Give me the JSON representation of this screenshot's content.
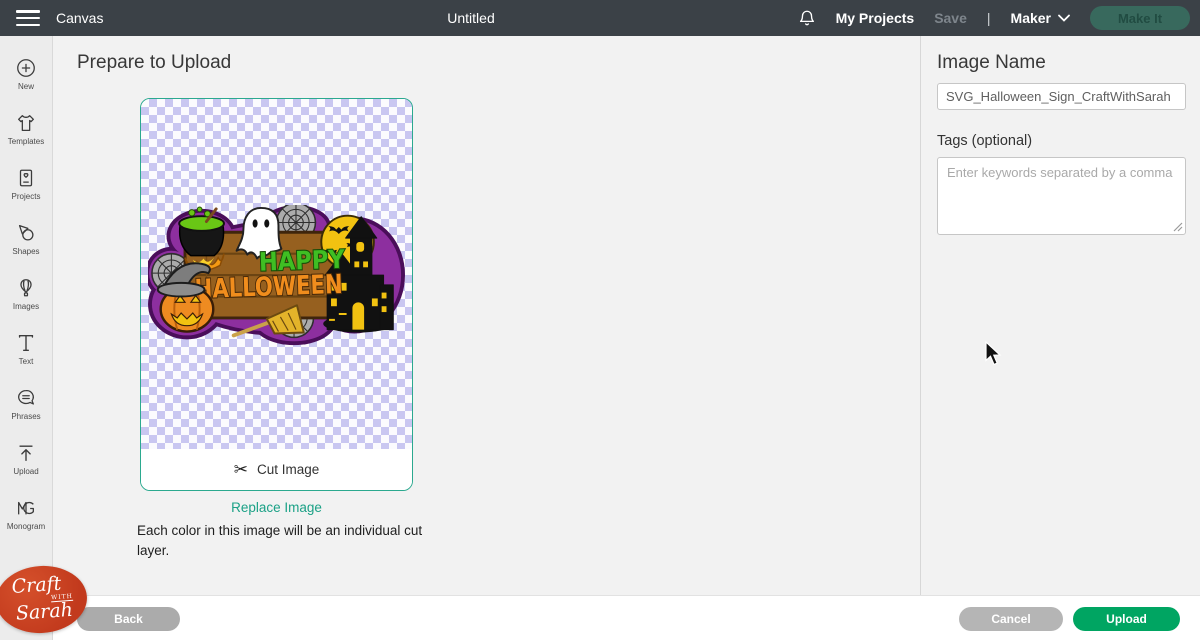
{
  "topbar": {
    "canvas_label": "Canvas",
    "title": "Untitled",
    "my_projects": "My Projects",
    "save": "Save",
    "separator": "|",
    "machine": "Maker",
    "make_it": "Make It",
    "icons": [
      "hamburger-menu-icon",
      "bell-icon",
      "chevron-down-icon"
    ]
  },
  "sidebar": {
    "items": [
      {
        "label": "New",
        "icon": "plus-circle-icon"
      },
      {
        "label": "Templates",
        "icon": "tshirt-icon"
      },
      {
        "label": "Projects",
        "icon": "project-card-icon"
      },
      {
        "label": "Shapes",
        "icon": "shapes-icon"
      },
      {
        "label": "Images",
        "icon": "balloon-image-icon"
      },
      {
        "label": "Text",
        "icon": "text-t-icon"
      },
      {
        "label": "Phrases",
        "icon": "speech-bubble-icon"
      },
      {
        "label": "Upload",
        "icon": "upload-arrow-icon"
      },
      {
        "label": "Monogram",
        "icon": "monogram-icon"
      }
    ]
  },
  "main": {
    "heading": "Prepare to Upload",
    "cut_image_label": "Cut Image",
    "cut_image_icon": "scissors-icon",
    "replace_image": "Replace Image",
    "note": "Each color in this image will be an individual cut layer.",
    "artwork": {
      "happy": "HAPPY",
      "halloween": "HALLOWEEN"
    }
  },
  "panel": {
    "image_name_heading": "Image Name",
    "image_name_value": "SVG_Halloween_Sign_CraftWithSarah",
    "tags_label": "Tags (optional)",
    "tags_placeholder": "Enter keywords separated by a comma"
  },
  "footer": {
    "back": "Back",
    "cancel": "Cancel",
    "upload": "Upload"
  },
  "logo": {
    "line1": "Craft",
    "with": "with",
    "line2": "Sarah"
  },
  "colors": {
    "topbar_bg": "#3b4147",
    "upload_green": "#00a562",
    "teal_link": "#1ba186",
    "preview_border": "#2ba98f",
    "checker_lavender": "#c9c7f1",
    "logo_red": "#c23a1d",
    "make_it_bg": "#38695d"
  }
}
